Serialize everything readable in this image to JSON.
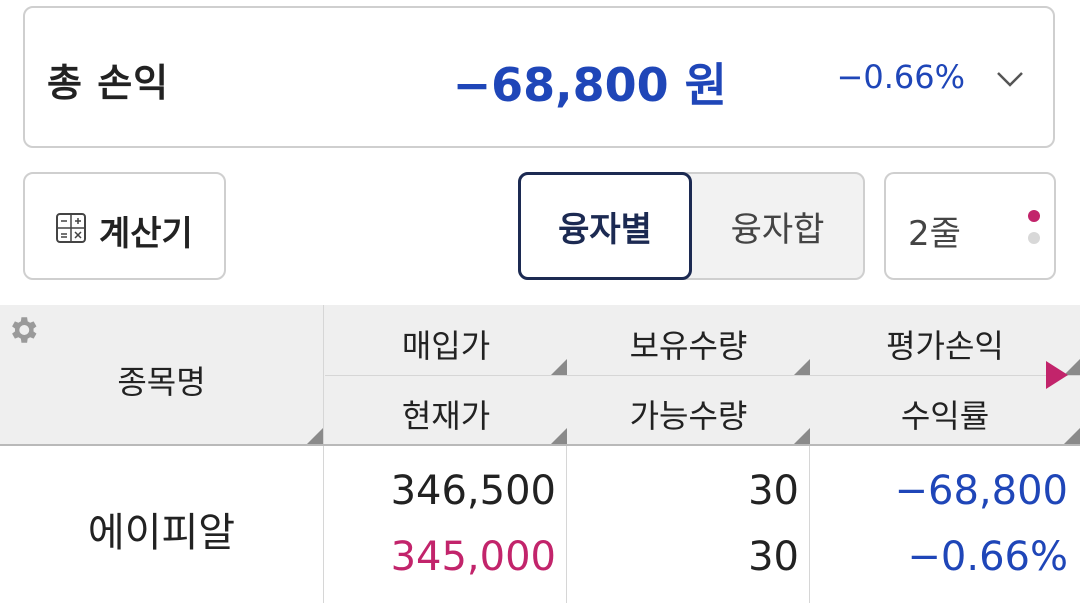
{
  "summary": {
    "label": "총 손익",
    "amount": "−68,800 원",
    "percent": "−0.66%"
  },
  "toolbar": {
    "calculator_label": "계산기",
    "segment_by_loan": "융자별",
    "segment_combined": "융자합",
    "rows_label": "2줄"
  },
  "table": {
    "header": {
      "name": "종목명",
      "col1_top": "매입가",
      "col1_bottom": "현재가",
      "col2_top": "보유수량",
      "col2_bottom": "가능수량",
      "col3_top": "평가손익",
      "col3_bottom": "수익률"
    },
    "rows": [
      {
        "name": "에이피알",
        "purchase_price": "346,500",
        "current_price": "345,000",
        "holding_qty": "30",
        "available_qty": "30",
        "profit_loss": "−68,800",
        "return_rate": "−0.66%"
      }
    ]
  },
  "colors": {
    "accent_blue": "#1f46b8",
    "accent_red": "#c2246b",
    "active_border": "#1c2a52"
  }
}
